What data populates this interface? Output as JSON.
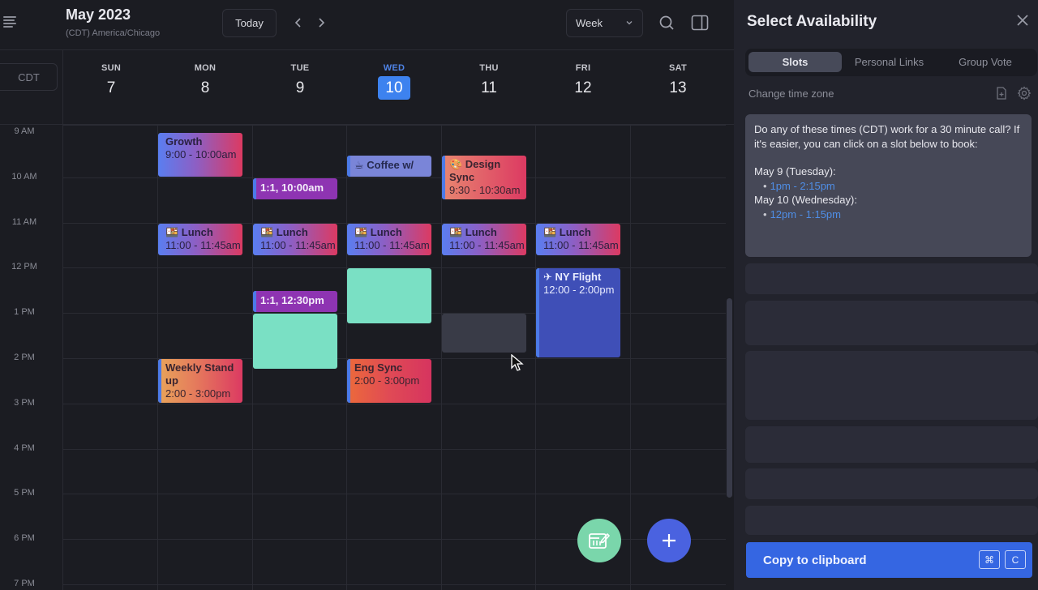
{
  "header": {
    "title": "May 2023",
    "timezone_label": "(CDT) America/Chicago",
    "today_label": "Today",
    "prev_icon": "chevron-left-icon",
    "next_icon": "chevron-right-icon",
    "view_select": {
      "selected": "Week"
    },
    "search_icon": "search-icon",
    "panel_toggle_icon": "sidebar-toggle-icon"
  },
  "calendar": {
    "tz_chip": "CDT",
    "days": [
      {
        "dow": "SUN",
        "num": "7",
        "today": false
      },
      {
        "dow": "MON",
        "num": "8",
        "today": false
      },
      {
        "dow": "TUE",
        "num": "9",
        "today": false
      },
      {
        "dow": "WED",
        "num": "10",
        "today": true
      },
      {
        "dow": "THU",
        "num": "11",
        "today": false
      },
      {
        "dow": "FRI",
        "num": "12",
        "today": false
      },
      {
        "dow": "SAT",
        "num": "13",
        "today": false
      }
    ],
    "hours": [
      "9 AM",
      "10 AM",
      "11 AM",
      "12 PM",
      "1 PM",
      "2 PM",
      "3 PM",
      "4 PM",
      "5 PM",
      "6 PM",
      "7 PM"
    ],
    "events": [
      {
        "day": 1,
        "start": 9.0,
        "end": 10.0,
        "title": "Growth",
        "time": "9:00 - 10:00am",
        "style": "grad-blue-red",
        "bar": false
      },
      {
        "day": 2,
        "start": 10.0,
        "end": 10.5,
        "title": "1:1, 10:00am",
        "time": "",
        "style": "purple",
        "bar": true
      },
      {
        "day": 3,
        "start": 9.5,
        "end": 10.0,
        "title": "☕ Coffee w/",
        "time": "",
        "style": "coffee",
        "bar": true
      },
      {
        "day": 4,
        "start": 9.5,
        "end": 10.5,
        "title": "🎨 Design Sync",
        "time": "9:30 - 10:30am",
        "style": "grad-peach",
        "bar": true
      },
      {
        "day": 1,
        "start": 11.0,
        "end": 11.75,
        "title": "🍱 Lunch",
        "time": "11:00 - 11:45am",
        "style": "grad-blue-red",
        "bar": false
      },
      {
        "day": 2,
        "start": 11.0,
        "end": 11.75,
        "title": "🍱 Lunch",
        "time": "11:00 - 11:45am",
        "style": "grad-blue-red",
        "bar": false
      },
      {
        "day": 3,
        "start": 11.0,
        "end": 11.75,
        "title": "🍱 Lunch",
        "time": "11:00 - 11:45am",
        "style": "grad-blue-red",
        "bar": false
      },
      {
        "day": 4,
        "start": 11.0,
        "end": 11.75,
        "title": "🍱 Lunch",
        "time": "11:00 - 11:45am",
        "style": "grad-blue-red",
        "bar": false
      },
      {
        "day": 5,
        "start": 11.0,
        "end": 11.75,
        "title": "🍱 Lunch",
        "time": "11:00 - 11:45am",
        "style": "grad-blue-red",
        "bar": false
      },
      {
        "day": 2,
        "start": 12.5,
        "end": 13.0,
        "title": "1:1, 12:30pm",
        "time": "",
        "style": "purple",
        "bar": true
      },
      {
        "day": 5,
        "start": 12.0,
        "end": 14.0,
        "title": "✈ NY Flight",
        "time": "12:00 - 2:00pm",
        "style": "flight",
        "bar": true
      },
      {
        "day": 1,
        "start": 14.0,
        "end": 15.0,
        "title": "Weekly Stand up",
        "time": "2:00 - 3:00pm",
        "style": "grad-orange",
        "bar": true
      },
      {
        "day": 3,
        "start": 14.0,
        "end": 15.0,
        "title": "Eng Sync",
        "time": "2:00 - 3:00pm",
        "style": "grad-eng",
        "bar": true
      }
    ],
    "availability_slots": [
      {
        "day": 2,
        "start": 13.0,
        "end": 14.25,
        "style": "mint"
      },
      {
        "day": 3,
        "start": 12.0,
        "end": 13.25,
        "style": "mint"
      }
    ],
    "hover_slot": {
      "day": 4,
      "start": 13.0,
      "end": 13.9
    },
    "fab_scheduler_icon": "calendar-edit-icon",
    "fab_add_icon": "plus-icon"
  },
  "panel": {
    "title": "Select Availability",
    "close_icon": "close-icon",
    "tabs": [
      {
        "label": "Slots",
        "active": true
      },
      {
        "label": "Personal Links",
        "active": false
      },
      {
        "label": "Group Vote",
        "active": false
      }
    ],
    "change_tz_label": "Change time zone",
    "message": {
      "intro": "Do any of these times (CDT) work for a 30 minute call? If it's easier, you can click on a slot below to book:",
      "groups": [
        {
          "heading": "May 9 (Tuesday):",
          "slots": [
            "1pm - 2:15pm"
          ]
        },
        {
          "heading": "May 10 (Wednesday):",
          "slots": [
            "12pm - 1:15pm"
          ]
        }
      ]
    },
    "copy_button": {
      "label": "Copy to clipboard",
      "keys": [
        "⌘",
        "C"
      ]
    }
  },
  "colors": {
    "accent": "#3d82ef",
    "copy_button": "#3566e2",
    "availability": "#7ae0c4",
    "fab_add": "#4a62e0",
    "fab_scheduler": "#7ad6ab"
  }
}
